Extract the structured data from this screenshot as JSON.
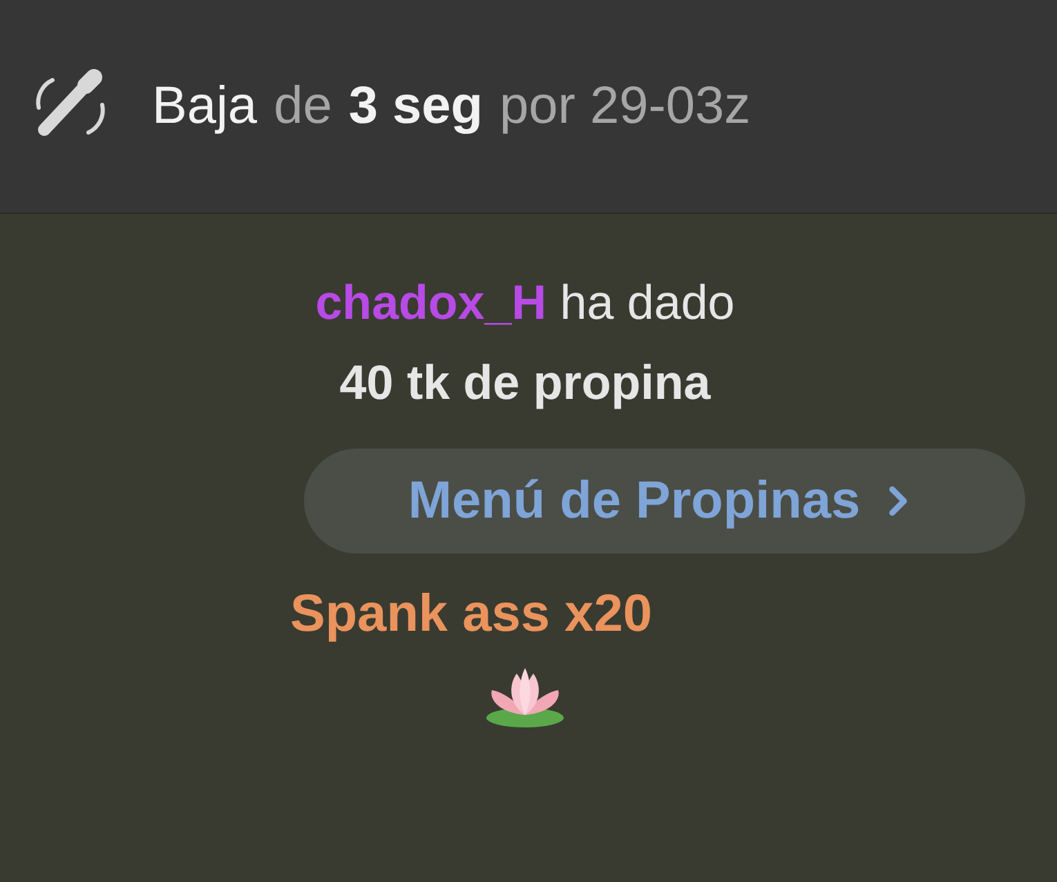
{
  "notice": {
    "parts": [
      {
        "text": "Baja",
        "kind": "plain"
      },
      {
        "text": "de",
        "kind": "muted"
      },
      {
        "text": "3 seg",
        "kind": "strong"
      },
      {
        "text": "por 29-03z",
        "kind": "muted"
      }
    ]
  },
  "tip": {
    "user": "chadox_H",
    "text": "ha dado **40 tk de propina**"
  },
  "menu_button": {
    "label": "Menú de Propinas"
  },
  "item": "Spank ass x20"
}
